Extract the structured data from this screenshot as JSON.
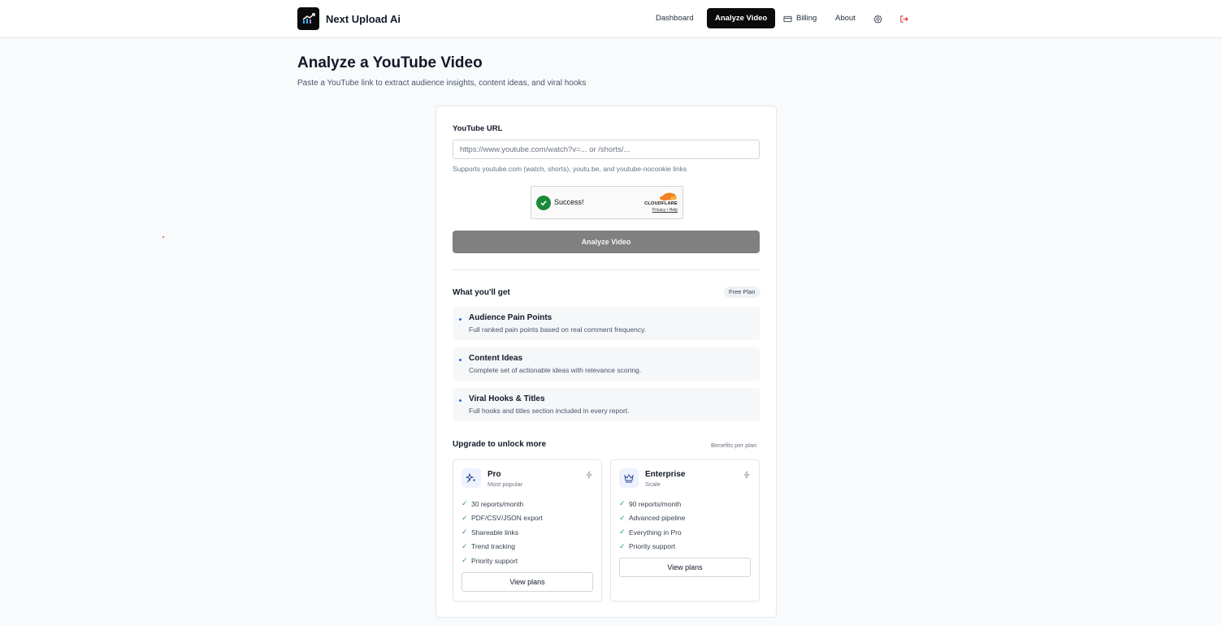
{
  "header": {
    "brand": "Next Upload Ai",
    "nav": {
      "dashboard": "Dashboard",
      "analyze": "Analyze Video",
      "billing": "Billing",
      "about": "About"
    },
    "icons": {
      "billing": "card-icon",
      "settings": "gear-icon",
      "logout": "logout-icon"
    }
  },
  "page": {
    "title": "Analyze a YouTube Video",
    "subtitle": "Paste a YouTube link to extract audience insights, content ideas, and viral hooks"
  },
  "form": {
    "url_label": "YouTube URL",
    "url_value": "",
    "url_placeholder": "https://www.youtube.com/watch?v=... or /shorts/...",
    "hint": "Supports youtube.com (watch, shorts), youtu.be, and youtube-nocookie links",
    "captcha": {
      "status": "Success!",
      "provider": "CLOUDFLARE",
      "links": "Privacy • Help"
    },
    "submit_label": "Analyze Video"
  },
  "features": {
    "title": "What you'll get",
    "badge": "Free Plan",
    "items": [
      {
        "title": "Audience Pain Points",
        "desc": "Full ranked pain points based on real comment frequency."
      },
      {
        "title": "Content Ideas",
        "desc": "Complete set of actionable ideas with relevance scoring."
      },
      {
        "title": "Viral Hooks & Titles",
        "desc": "Full hooks and titles section included in every report."
      }
    ]
  },
  "upgrade": {
    "title": "Upgrade to unlock more",
    "note": "Benefits per plan",
    "plans": [
      {
        "name": "Pro",
        "tag": "Most popular",
        "items": [
          "30 reports/month",
          "PDF/CSV/JSON export",
          "Shareable links",
          "Trend tracking",
          "Priority support"
        ],
        "button": "View plans"
      },
      {
        "name": "Enterprise",
        "tag": "Scale",
        "items": [
          "90 reports/month",
          "Advanced pipeline",
          "Everything in Pro",
          "Priority support"
        ],
        "button": "View plans"
      }
    ]
  },
  "colors": {
    "accent": "#0b0b0b",
    "button_disabled": "#808080",
    "success": "#1a8a3a",
    "bullet": "#2563eb",
    "logout": "#dc2626"
  }
}
